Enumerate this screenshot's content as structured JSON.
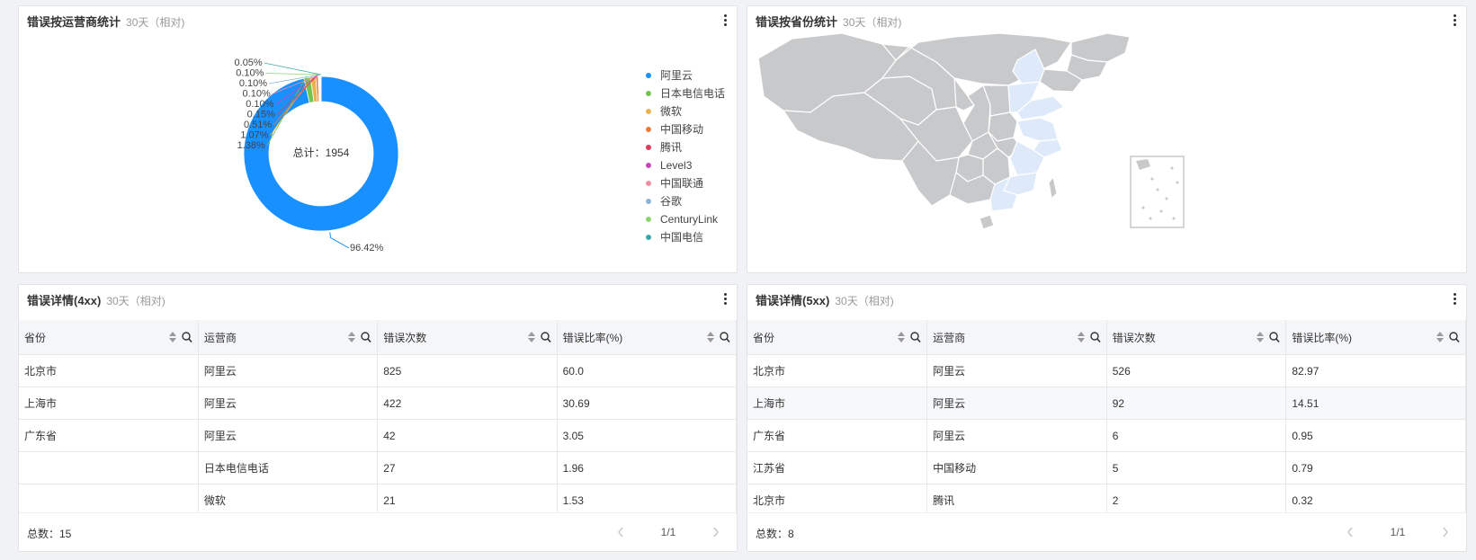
{
  "carrier_panel": {
    "title": "错误按运营商统计",
    "subtitle": "30天（相对)"
  },
  "province_panel": {
    "title": "错误按省份统计",
    "subtitle": "30天（相对)"
  },
  "chart_data": {
    "type": "pie",
    "center_label": "总计：1954",
    "slices": [
      {
        "name": "阿里云",
        "value": 96.42,
        "label": "96.42%",
        "color": "#1890ff"
      },
      {
        "name": "日本电信电话",
        "value": 1.38,
        "label": "1.38%",
        "color": "#73c34f"
      },
      {
        "name": "微软",
        "value": 1.07,
        "label": "1.07%",
        "color": "#e8b24d"
      },
      {
        "name": "中国移动",
        "value": 0.51,
        "label": "0.51%",
        "color": "#f07c3c"
      },
      {
        "name": "腾讯",
        "value": 0.15,
        "label": "0.15%",
        "color": "#e0395a"
      },
      {
        "name": "Level3",
        "value": 0.1,
        "label": "0.10%",
        "color": "#c946b8"
      },
      {
        "name": "中国联通",
        "value": 0.1,
        "label": "0.10%",
        "color": "#ee8fa3"
      },
      {
        "name": "谷歌",
        "value": 0.1,
        "label": "0.10%",
        "color": "#8ab4d8"
      },
      {
        "name": "CenturyLink",
        "value": 0.1,
        "label": "0.10%",
        "color": "#8ed46f"
      },
      {
        "name": "中国电信",
        "value": 0.05,
        "label": "0.05%",
        "color": "#3aa8a8"
      }
    ]
  },
  "map": {
    "base_color": "#c8c9cb",
    "highlight_color": "#deeafa",
    "border_color": "#ffffff"
  },
  "table_4xx": {
    "title": "错误详情(4xx)",
    "subtitle": "30天（相对)",
    "columns": [
      "省份",
      "运营商",
      "错误次数",
      "错误比率(%)"
    ],
    "rows": [
      [
        "北京市",
        "阿里云",
        "825",
        "60.0"
      ],
      [
        "上海市",
        "阿里云",
        "422",
        "30.69"
      ],
      [
        "广东省",
        "阿里云",
        "42",
        "3.05"
      ],
      [
        "",
        "日本电信电话",
        "27",
        "1.96"
      ],
      [
        "",
        "微软",
        "21",
        "1.53"
      ]
    ],
    "total": "总数：15",
    "page": "1/1"
  },
  "table_5xx": {
    "title": "错误详情(5xx)",
    "subtitle": "30天（相对)",
    "columns": [
      "省份",
      "运营商",
      "错误次数",
      "错误比率(%)"
    ],
    "rows": [
      [
        "北京市",
        "阿里云",
        "526",
        "82.97"
      ],
      [
        "上海市",
        "阿里云",
        "92",
        "14.51"
      ],
      [
        "广东省",
        "阿里云",
        "6",
        "0.95"
      ],
      [
        "江苏省",
        "中国移动",
        "5",
        "0.79"
      ],
      [
        "北京市",
        "腾讯",
        "2",
        "0.32"
      ]
    ],
    "total": "总数：8",
    "page": "1/1"
  }
}
